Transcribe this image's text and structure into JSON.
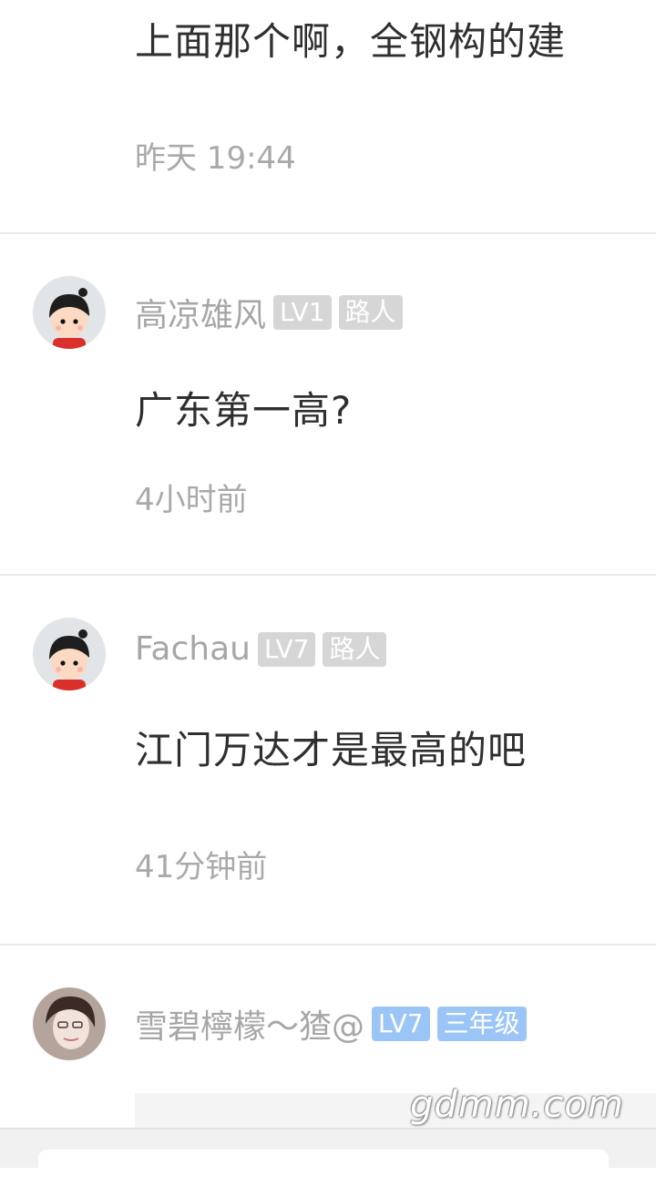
{
  "comments": [
    {
      "text": "上面那个啊，全钢构的建",
      "time": "昨天 19:44"
    },
    {
      "username": "高凉雄风",
      "level": "LV1",
      "title": "路人",
      "text": "广东第一高?",
      "time": "4小时前",
      "avatar_icon": "cartoon-avatar-icon"
    },
    {
      "username": "Fachau",
      "level": "LV7",
      "title": "路人",
      "text": "江门万达才是最高的吧",
      "time": "41分钟前",
      "avatar_icon": "cartoon-avatar-icon"
    },
    {
      "username": "雪碧檸檬～猹@",
      "level": "LV7",
      "title": "三年级",
      "avatar_icon": "photo-avatar-icon"
    }
  ],
  "watermark": "gdmm.com",
  "colors": {
    "badge_gray": "#d6d6d6",
    "badge_blue": "#9cc5f7",
    "divider": "#e9e9e9"
  }
}
